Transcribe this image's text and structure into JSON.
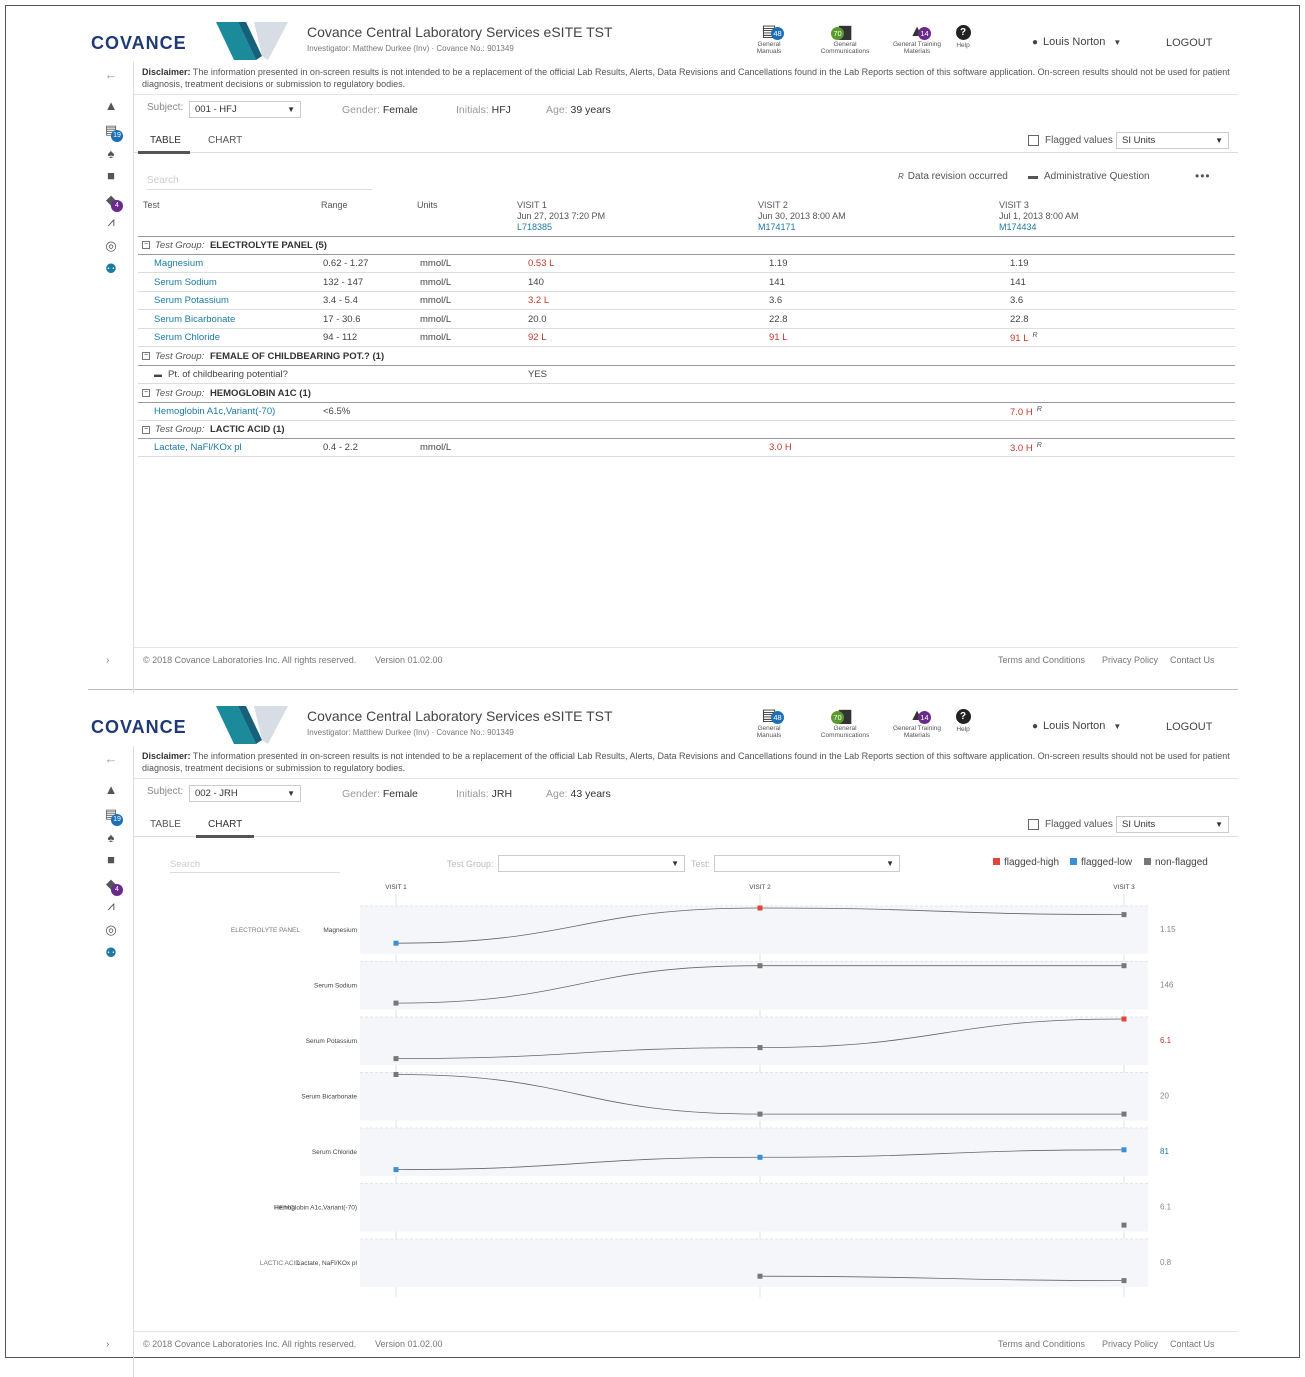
{
  "header": {
    "logo": "COVANCE",
    "app_title": "Covance Central Laboratory Services eSITE TST",
    "subtitle": "Investigator: Matthew Durkee (Inv) · Covance No.: 901349",
    "user": "Louis Norton",
    "logout": "LOGOUT",
    "icons": [
      {
        "name": "manuals",
        "label1": "General",
        "label2": "Manuals",
        "badge": "48",
        "color": "#1c6fb5"
      },
      {
        "name": "communications",
        "label1": "General",
        "label2": "Communications",
        "badge": "70",
        "color": "#5a9a2c"
      },
      {
        "name": "training",
        "label1": "General Training",
        "label2": "Materials",
        "badge": "14",
        "color": "#6a2a8c"
      },
      {
        "name": "help",
        "label1": "Help",
        "label2": "",
        "badge": "",
        "color": ""
      }
    ]
  },
  "sidebar": {
    "back": "←",
    "expand": "›",
    "badge_docs": "19",
    "badge_training": "4"
  },
  "disclaimer": {
    "label": "Disclaimer:",
    "text": " The information presented in on-screen results is not intended to be a replacement of the official Lab Results, Alerts, Data Revisions and Cancellations found in the Lab Reports section of this software application. On-screen results should not be used for patient diagnosis, treatment decisions or submission to regulatory bodies."
  },
  "labels": {
    "subject": "Subject:",
    "gender": "Gender:",
    "initials": "Initials:",
    "age": "Age:",
    "tab_table": "TABLE",
    "tab_chart": "CHART",
    "flagged": "Flagged values",
    "search": "Search",
    "data_revision": "Data revision occurred",
    "admin_q": "Administrative Question",
    "more": "•••",
    "test_group": "Test Group:",
    "test": "Test:"
  },
  "footer": {
    "copyright": "© 2018 Covance Laboratories Inc. All rights reserved.",
    "version": "Version 01.02.00",
    "terms": "Terms and Conditions",
    "privacy": "Privacy Policy",
    "contact": "Contact Us"
  },
  "table_view": {
    "subject": "001 - HFJ",
    "gender": "Female",
    "initials": "HFJ",
    "age": "39 years",
    "units": "SI Units",
    "columns": {
      "test": "Test",
      "range": "Range",
      "units": "Units"
    },
    "visits": [
      {
        "name": "VISIT 1",
        "date": "Jun 27, 2013 7:20 PM",
        "id": "L718385"
      },
      {
        "name": "VISIT 2",
        "date": "Jun 30, 2013 8:00 AM",
        "id": "M174171"
      },
      {
        "name": "VISIT 3",
        "date": "Jul 1, 2013 8:00 AM",
        "id": "M174434"
      }
    ],
    "groups": [
      {
        "name": "ELECTROLYTE PANEL (5)",
        "rows": [
          {
            "test": "Magnesium",
            "range": "0.62 - 1.27",
            "units": "mmol/L",
            "v1": "0.53 L",
            "v2": "1.19",
            "v3": "1.19",
            "f1": true,
            "f2": false,
            "f3": false,
            "r3": false
          },
          {
            "test": "Serum Sodium",
            "range": "132 - 147",
            "units": "mmol/L",
            "v1": "140",
            "v2": "141",
            "v3": "141",
            "f1": false,
            "f2": false,
            "f3": false,
            "r3": false
          },
          {
            "test": "Serum Potassium",
            "range": "3.4 - 5.4",
            "units": "mmol/L",
            "v1": "3.2 L",
            "v2": "3.6",
            "v3": "3.6",
            "f1": true,
            "f2": false,
            "f3": false,
            "r3": false
          },
          {
            "test": "Serum Bicarbonate",
            "range": "17 - 30.6",
            "units": "mmol/L",
            "v1": "20.0",
            "v2": "22.8",
            "v3": "22.8",
            "f1": false,
            "f2": false,
            "f3": false,
            "r3": false
          },
          {
            "test": "Serum Chloride",
            "range": "94 - 112",
            "units": "mmol/L",
            "v1": "92 L",
            "v2": "91 L",
            "v3": "91 L",
            "f1": true,
            "f2": true,
            "f3": true,
            "r3": true
          }
        ]
      },
      {
        "name": "FEMALE OF CHILDBEARING POT.? (1)",
        "rows": [
          {
            "test": "Pt. of childbearing potential?",
            "range": "",
            "units": "",
            "v1": "YES",
            "v2": "",
            "v3": "",
            "f1": false,
            "f2": false,
            "f3": false,
            "r3": false,
            "question": true
          }
        ]
      },
      {
        "name": "HEMOGLOBIN A1C (1)",
        "rows": [
          {
            "test": "Hemoglobin A1c,Variant(-70)",
            "range": "<6.5%",
            "units": "",
            "v1": "",
            "v2": "",
            "v3": "7.0 H",
            "f1": false,
            "f2": false,
            "f3": true,
            "r3": true
          }
        ]
      },
      {
        "name": "LACTIC ACID (1)",
        "rows": [
          {
            "test": "Lactate, NaFl/KOx pl",
            "range": "0.4 - 2.2",
            "units": "mmol/L",
            "v1": "",
            "v2": "3.0 H",
            "v3": "3.0 H",
            "f1": false,
            "f2": true,
            "f3": true,
            "r3": true
          }
        ]
      }
    ]
  },
  "chart_view": {
    "subject": "002 - JRH",
    "gender": "Female",
    "initials": "JRH",
    "age": "43 years",
    "units": "SI Units"
  },
  "chart_data": {
    "type": "line",
    "x": [
      "VISIT 1",
      "VISIT 2",
      "VISIT 3"
    ],
    "legend": [
      {
        "label": "flagged-high",
        "color": "#e0463a"
      },
      {
        "label": "flagged-low",
        "color": "#3a8fd6"
      },
      {
        "label": "non-flagged",
        "color": "#777777"
      }
    ],
    "series": [
      {
        "group": "ELECTROLYTE PANEL",
        "name": "Magnesium",
        "last_label": "1.15",
        "label_color": "#888",
        "points": [
          {
            "visit": 1,
            "level": 0.2,
            "flag": "low"
          },
          {
            "visit": 2,
            "level": 1.0,
            "flag": "high"
          },
          {
            "visit": 3,
            "level": 0.85,
            "flag": "none"
          }
        ]
      },
      {
        "group": "",
        "name": "Serum Sodium",
        "last_label": "146",
        "label_color": "#888",
        "points": [
          {
            "visit": 1,
            "level": 0.1,
            "flag": "none"
          },
          {
            "visit": 2,
            "level": 0.95,
            "flag": "none"
          },
          {
            "visit": 3,
            "level": 0.95,
            "flag": "none"
          }
        ]
      },
      {
        "group": "",
        "name": "Serum Potassium",
        "last_label": "6.1",
        "label_color": "#c0392b",
        "points": [
          {
            "visit": 1,
            "level": 0.1,
            "flag": "none"
          },
          {
            "visit": 2,
            "level": 0.35,
            "flag": "none"
          },
          {
            "visit": 3,
            "level": 1.0,
            "flag": "high"
          }
        ]
      },
      {
        "group": "",
        "name": "Serum Bicarbonate",
        "last_label": "20",
        "label_color": "#888",
        "points": [
          {
            "visit": 1,
            "level": 1.0,
            "flag": "none"
          },
          {
            "visit": 2,
            "level": 0.1,
            "flag": "none"
          },
          {
            "visit": 3,
            "level": 0.1,
            "flag": "none"
          }
        ]
      },
      {
        "group": "",
        "name": "Serum Chloride",
        "last_label": "81",
        "label_color": "#1c7aa3",
        "points": [
          {
            "visit": 1,
            "level": 0.1,
            "flag": "low"
          },
          {
            "visit": 2,
            "level": 0.38,
            "flag": "low"
          },
          {
            "visit": 3,
            "level": 0.55,
            "flag": "low"
          }
        ]
      },
      {
        "group": "HEMO...",
        "name": "Hemoglobin A1c,Variant(-70)",
        "last_label": "6.1",
        "label_color": "#888",
        "points": [
          {
            "visit": 3,
            "level": 0.1,
            "flag": "none"
          }
        ]
      },
      {
        "group": "LACTIC ACID",
        "name": "Lactate, NaFl/KOx pl",
        "last_label": "0.8",
        "label_color": "#888",
        "points": [
          {
            "visit": 2,
            "level": 0.2,
            "flag": "none"
          },
          {
            "visit": 3,
            "level": 0.1,
            "flag": "none"
          }
        ]
      }
    ]
  }
}
